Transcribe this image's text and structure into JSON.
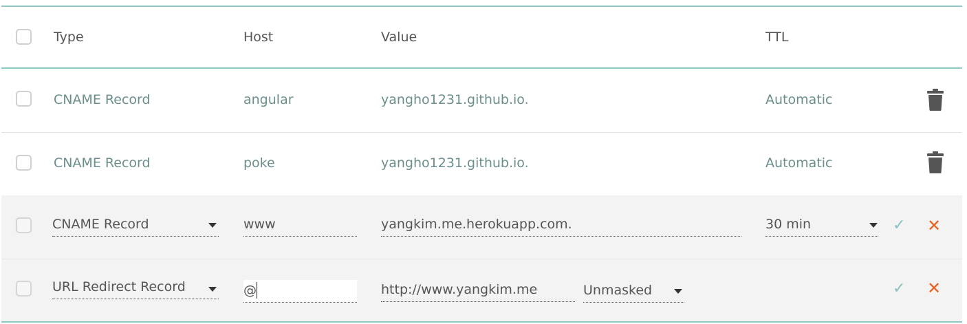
{
  "header": {
    "type_label": "Type",
    "host_label": "Host",
    "value_label": "Value",
    "ttl_label": "TTL"
  },
  "records": [
    {
      "type": "CNAME Record",
      "host": "angular",
      "value": "yangho1231.github.io.",
      "ttl": "Automatic"
    },
    {
      "type": "CNAME Record",
      "host": "poke",
      "value": "yangho1231.github.io.",
      "ttl": "Automatic"
    }
  ],
  "edit_rows": [
    {
      "type": "CNAME Record",
      "host": "www",
      "value": "yangkim.me.herokuapp.com.",
      "ttl": "30 min"
    },
    {
      "type": "URL Redirect Record",
      "host": "@",
      "value": "http://www.yangkim.me",
      "redirect_mode": "Unmasked"
    }
  ],
  "icons": {
    "delete": "trash-icon",
    "save": "checkmark-icon",
    "cancel": "close-icon",
    "dropdown": "chevron-down-icon"
  },
  "colors": {
    "accent_line": "#8ec8c2",
    "record_text": "#6b8f8c",
    "save": "#87c1bd",
    "cancel": "#e8621e"
  },
  "glyphs": {
    "check": "✓",
    "cross": "✕"
  }
}
